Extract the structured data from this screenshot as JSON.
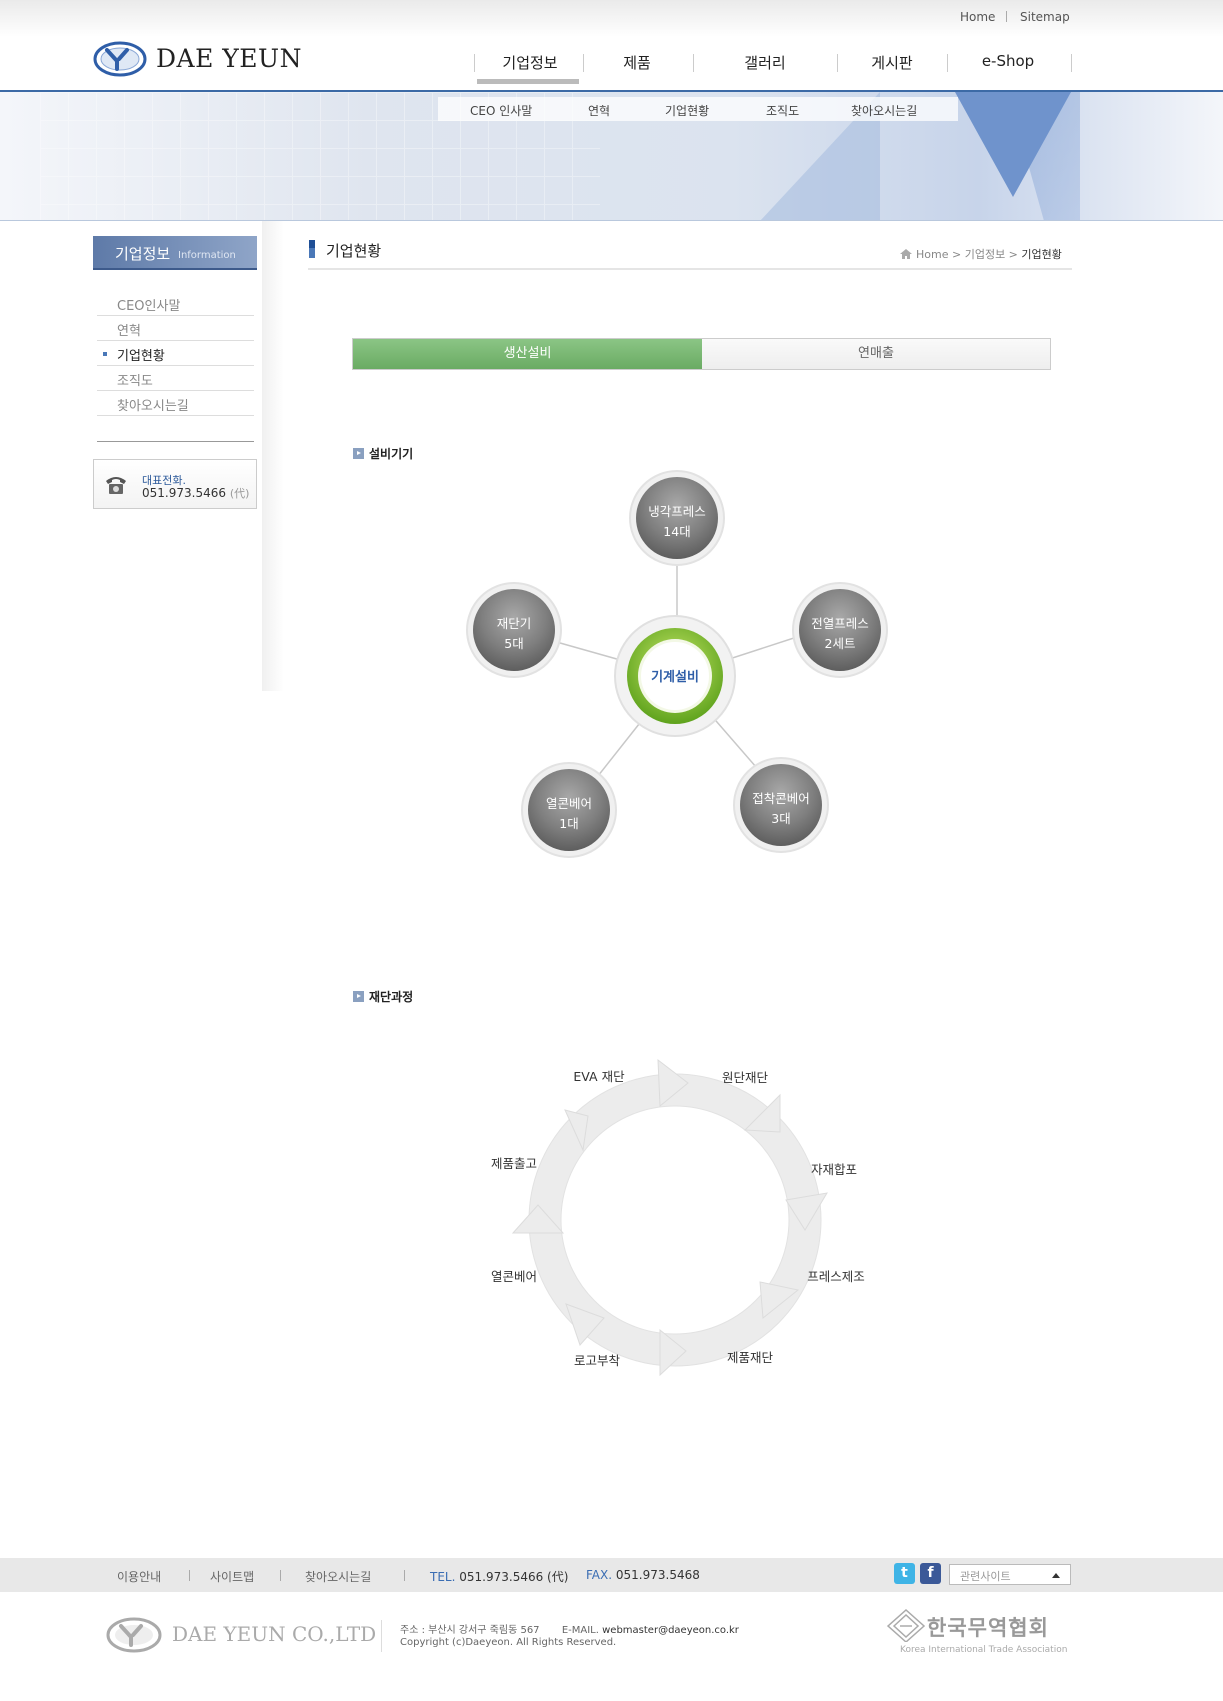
{
  "util_nav": {
    "home": "Home",
    "sitemap": "Sitemap"
  },
  "logo": {
    "text": "DAE YEUN"
  },
  "gnb": [
    "기업정보",
    "제품",
    "갤러리",
    "게시판",
    "e-Shop"
  ],
  "lnb": [
    "CEO 인사말",
    "연혁",
    "기업현황",
    "조직도",
    "찾아오시는길"
  ],
  "sidebar": {
    "title": "기업정보",
    "title_en": "Information",
    "items": [
      "CEO인사말",
      "연혁",
      "기업현황",
      "조직도",
      "찾아오시는길"
    ],
    "active_index": 2,
    "phone_label": "대표전화.",
    "phone_number": "051.973.5466",
    "phone_suffix": "(代)"
  },
  "page": {
    "title": "기업현황",
    "breadcrumb": {
      "home": "Home",
      "level1": "기업정보",
      "current": "기업현황"
    }
  },
  "tabs": {
    "active": "생산설비",
    "inactive": "연매출"
  },
  "section1": {
    "title": "설비기기",
    "center": "기계설비",
    "nodes": [
      {
        "name": "냉각프레스",
        "count": "14대"
      },
      {
        "name": "전열프레스",
        "count": "2세트"
      },
      {
        "name": "접착콘베어",
        "count": "3대"
      },
      {
        "name": "열콘베어",
        "count": "1대"
      },
      {
        "name": "재단기",
        "count": "5대"
      }
    ]
  },
  "section2": {
    "title": "재단과정",
    "steps": [
      "EVA 재단",
      "원단재단",
      "자재합포",
      "프레스제조",
      "제품재단",
      "로고부착",
      "열콘베어",
      "제품출고"
    ]
  },
  "footer": {
    "links": [
      "이용안내",
      "사이트맵",
      "찾아오시는길"
    ],
    "tel_label": "TEL.",
    "tel": "051.973.5466 (代)",
    "fax_label": "FAX.",
    "fax": "051.973.5468",
    "related_sites": "관련사이트",
    "company": "DAE YEUN CO.,LTD",
    "address": "주소 : 부산시 강서구 죽림동 567",
    "email_label": "E-MAIL.",
    "email": "webmaster@daeyeon.co.kr",
    "copyright": "Copyright (c)Daeyeon. All Rights Reserved.",
    "kita_ko": "한국무역협회",
    "kita_en": "Korea International Trade Association"
  },
  "colors": {
    "brand_blue": "#3c6aa6",
    "tab_green": "#6aab63",
    "ring_green": "#8cc63f",
    "node_gray": "#7a7a7a"
  }
}
